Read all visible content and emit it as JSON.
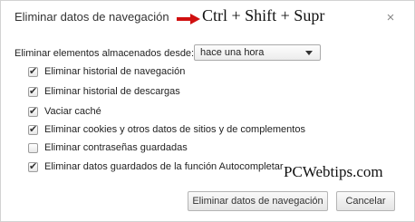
{
  "dialog": {
    "title": "Eliminar datos de navegación",
    "shortcut": "Ctrl + Shift + Supr",
    "close_label": "×",
    "arrow_color": "#d01010"
  },
  "range": {
    "label": "Eliminar elementos almacenados desde:",
    "selected": "hace una hora"
  },
  "options": [
    {
      "label": "Eliminar historial de navegación",
      "checked": true
    },
    {
      "label": "Eliminar historial de descargas",
      "checked": true
    },
    {
      "label": "Vaciar caché",
      "checked": true
    },
    {
      "label": "Eliminar cookies y otros datos de sitios y de complementos",
      "checked": true
    },
    {
      "label": "Eliminar contraseñas guardadas",
      "checked": false
    },
    {
      "label": "Eliminar datos guardados de la función Autocompletar",
      "checked": true
    }
  ],
  "watermark": "PCWebtips.com",
  "buttons": {
    "clear": "Eliminar datos de navegación",
    "cancel": "Cancelar"
  }
}
